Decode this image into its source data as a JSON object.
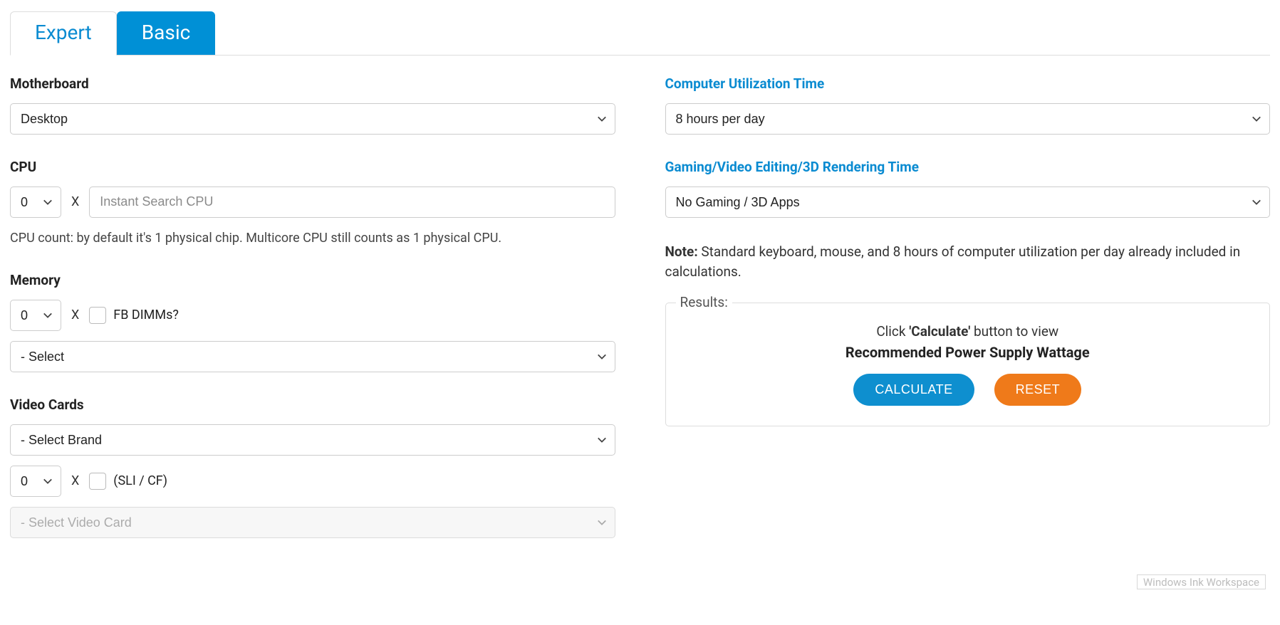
{
  "tabs": {
    "expert": "Expert",
    "basic": "Basic"
  },
  "left": {
    "motherboard": {
      "label": "Motherboard",
      "value": "Desktop"
    },
    "cpu": {
      "label": "CPU",
      "count": "0",
      "x": "X",
      "placeholder": "Instant Search CPU",
      "hint": "CPU count: by default it's 1 physical chip. Multicore CPU still counts as 1 physical CPU."
    },
    "memory": {
      "label": "Memory",
      "count": "0",
      "x": "X",
      "fb_label": "FB DIMMs?",
      "type": "- Select"
    },
    "video": {
      "label": "Video Cards",
      "brand": "- Select Brand",
      "count": "0",
      "x": "X",
      "sli_label": "(SLI / CF)",
      "card": "- Select Video Card"
    }
  },
  "right": {
    "util": {
      "label": "Computer Utilization Time",
      "value": "8 hours per day"
    },
    "gaming": {
      "label": "Gaming/Video Editing/3D Rendering Time",
      "value": "No Gaming / 3D Apps"
    },
    "note_bold": "Note:",
    "note_text": " Standard keyboard, mouse, and 8 hours of computer utilization per day already included in calculations.",
    "results": {
      "legend": "Results:",
      "line1_pre": "Click ",
      "line1_bold": "'Calculate'",
      "line1_post": " button to view",
      "line2": "Recommended Power Supply Wattage",
      "calc": "CALCULATE",
      "reset": "RESET"
    }
  },
  "watermark": "Windows Ink Workspace"
}
